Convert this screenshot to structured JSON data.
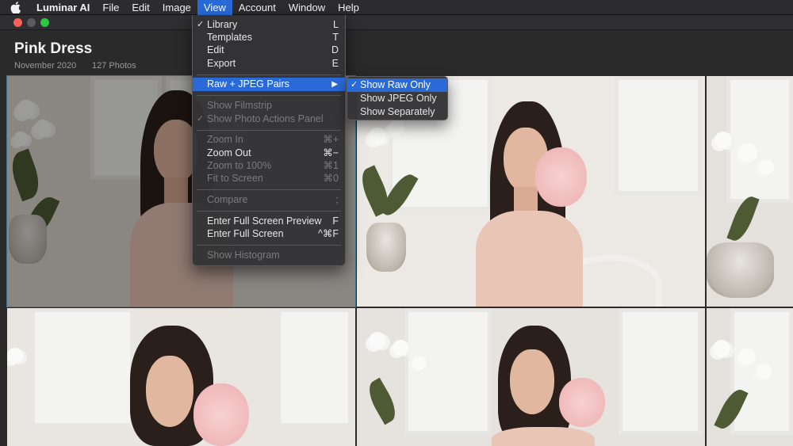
{
  "menubar": {
    "apple_icon": "apple-logo-icon",
    "items": [
      {
        "label": "Luminar AI"
      },
      {
        "label": "File"
      },
      {
        "label": "Edit"
      },
      {
        "label": "Image"
      },
      {
        "label": "View"
      },
      {
        "label": "Account"
      },
      {
        "label": "Window"
      },
      {
        "label": "Help"
      }
    ],
    "active": "View"
  },
  "album": {
    "title": "Pink Dress",
    "date": "November 2020",
    "count": "127 Photos"
  },
  "view_menu": {
    "items": [
      {
        "label": "Library",
        "shortcut": "L",
        "checked": "✓"
      },
      {
        "label": "Templates",
        "shortcut": "T"
      },
      {
        "label": "Edit",
        "shortcut": "D"
      },
      {
        "label": "Export",
        "shortcut": "E"
      },
      {
        "label": "Raw + JPEG Pairs",
        "arrow": "▶"
      },
      {
        "label": "Show Filmstrip"
      },
      {
        "label": "Show Photo Actions Panel",
        "checked": "✓"
      },
      {
        "label": "Zoom In",
        "shortcut": "⌘+"
      },
      {
        "label": "Zoom Out",
        "shortcut": "⌘−"
      },
      {
        "label": "Zoom to 100%",
        "shortcut": "⌘1"
      },
      {
        "label": "Fit to Screen",
        "shortcut": "⌘0"
      },
      {
        "label": "Compare",
        "shortcut": ";"
      },
      {
        "label": "Enter Full Screen Preview",
        "shortcut": "F"
      },
      {
        "label": "Enter Full Screen",
        "shortcut": "^⌘F"
      },
      {
        "label": "Show Histogram"
      }
    ]
  },
  "raw_jpeg_submenu": {
    "items": [
      {
        "label": "Show Raw Only",
        "checked": "✓"
      },
      {
        "label": "Show JPEG Only"
      },
      {
        "label": "Show Separately"
      }
    ]
  },
  "colors": {
    "selection": "#5fc0e8",
    "menu_highlight": "#2a6ad8"
  }
}
